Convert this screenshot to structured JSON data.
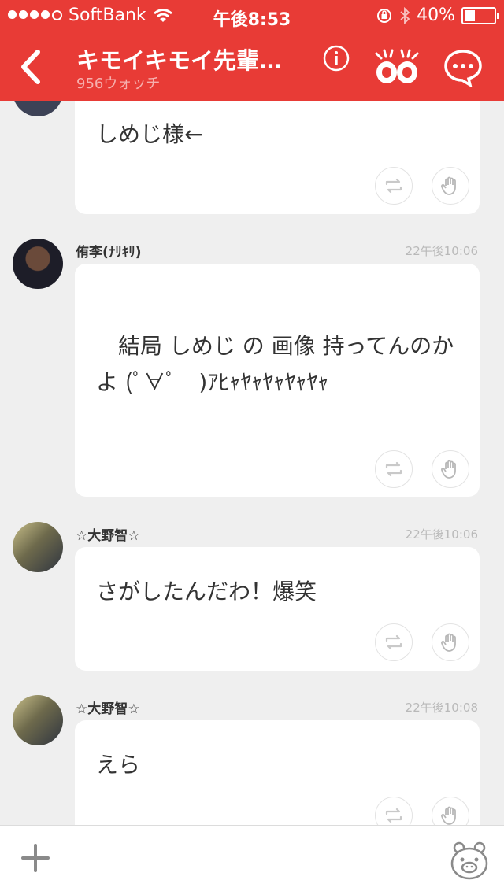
{
  "status_bar": {
    "carrier": "SoftBank",
    "time": "午後8:53",
    "battery": "40%",
    "battery_level": 0.4
  },
  "header": {
    "title": "キモイキモイ先輩…",
    "subtitle": "956ウォッチ"
  },
  "messages": [
    {
      "name": "",
      "time": "",
      "text": "しめじ様←"
    },
    {
      "name": "侑李(ﾅﾘｷﾘ)",
      "time": "22午後10:06",
      "text": "　結局 しめじ の 画像 持ってんのかよ (ﾟ∀ﾟ　)ｱﾋｬﾔｬﾔｬﾔｬﾔｬ"
    },
    {
      "name": "☆大野智☆",
      "time": "22午後10:06",
      "text": "さがしたんだわ！爆笑"
    },
    {
      "name": "☆大野智☆",
      "time": "22午後10:08",
      "text": "えら"
    }
  ],
  "colors": {
    "header_bg": "#e83b36",
    "page_bg": "#efefef",
    "bubble_bg": "#ffffff"
  }
}
